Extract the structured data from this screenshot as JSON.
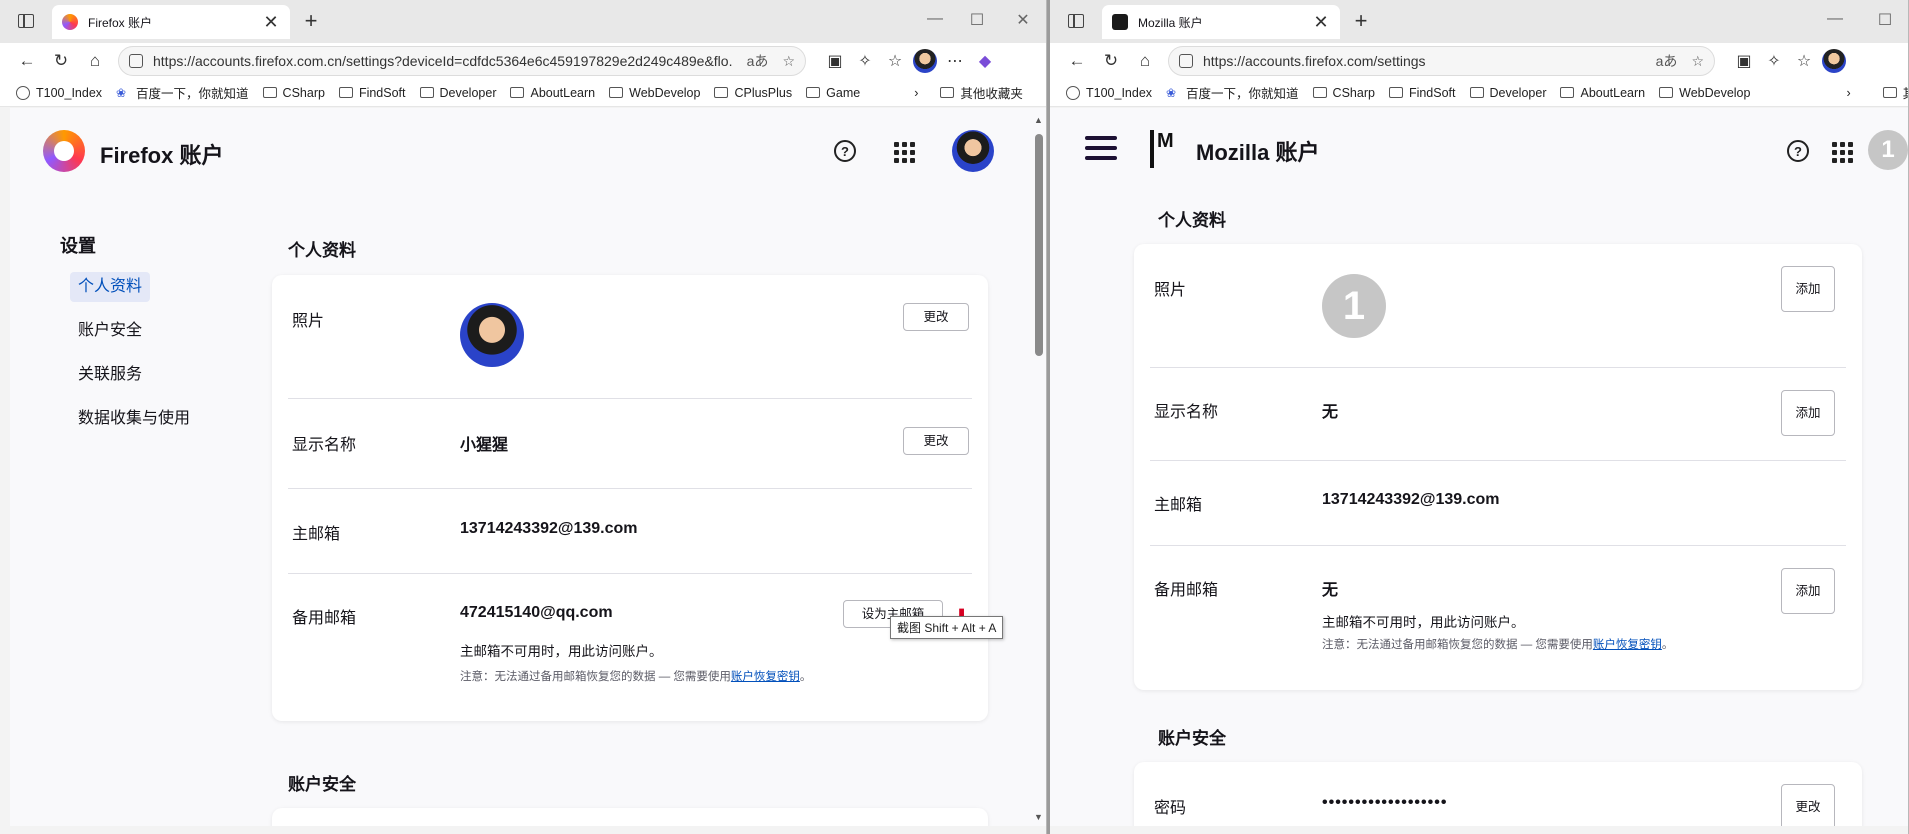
{
  "left": {
    "tab_title": "Firefox 账户",
    "url": "https://accounts.firefox.com.cn/settings?deviceId=cdfdc5364e6c459197829e2d249c489e&flo...",
    "bookmarks": [
      "T100_Index",
      "百度一下，你就知道",
      "CSharp",
      "FindSoft",
      "Developer",
      "AboutLearn",
      "WebDevelop",
      "CPlusPlus",
      "Game"
    ],
    "other_bookmarks": "其他收藏夹",
    "brand": "Firefox 账户",
    "sidebar": {
      "title": "设置",
      "items": [
        {
          "label": "个人资料"
        },
        {
          "label": "账户安全"
        },
        {
          "label": "关联服务"
        },
        {
          "label": "数据收集与使用"
        }
      ]
    },
    "profile": {
      "section_title": "个人资料",
      "photo_label": "照片",
      "photo_button": "更改",
      "display_name_label": "显示名称",
      "display_name_value": "小猩猩",
      "display_name_button": "更改",
      "primary_email_label": "主邮箱",
      "primary_email_value": "13714243392@139.com",
      "secondary_email_label": "备用邮箱",
      "secondary_email_value": "472415140@qq.com",
      "set_primary_button": "设为主邮箱",
      "secondary_desc": "主邮箱不可用时，用此访问账户。",
      "secondary_note": "注意：无法通过备用邮箱恢复您的数据 — 您需要使用",
      "secondary_link": "账户恢复密钥",
      "secondary_note_end": "。"
    },
    "tooltip": "截图 Shift + Alt + A",
    "security_title": "账户安全"
  },
  "right": {
    "tab_title": "Mozilla 账户",
    "url": "https://accounts.firefox.com/settings",
    "bookmarks": [
      "T100_Index",
      "百度一下，你就知道",
      "CSharp",
      "FindSoft",
      "Developer",
      "AboutLearn",
      "WebDevelop"
    ],
    "other_bookmarks": "其他",
    "brand": "Mozilla 账户",
    "avatar_letter": "1",
    "profile": {
      "section_title": "个人资料",
      "photo_label": "照片",
      "photo_letter": "1",
      "photo_button": "添加",
      "display_name_label": "显示名称",
      "display_name_value": "无",
      "display_name_button": "添加",
      "primary_email_label": "主邮箱",
      "primary_email_value": "13714243392@139.com",
      "secondary_email_label": "备用邮箱",
      "secondary_email_value": "无",
      "secondary_button": "添加",
      "secondary_desc": "主邮箱不可用时，用此访问账户。",
      "secondary_note": "注意：无法通过备用邮箱恢复您的数据 — 您需要使用",
      "secondary_link": "账户恢复密钥",
      "secondary_note_end": "。"
    },
    "security": {
      "section_title": "账户安全",
      "password_label": "密码",
      "password_value": "•••••••••••••••••••",
      "password_button": "更改"
    }
  },
  "icons": {
    "back": "←",
    "reload": "↻",
    "home": "⌂",
    "more": "⋯",
    "new_tab": "+",
    "close": "✕",
    "minimize": "—",
    "maximize": "☐",
    "chevron": "›",
    "star": "☆",
    "read_aloud": "aあ",
    "trash": "🗑"
  },
  "colors": {
    "link": "#0250bb",
    "active_nav_bg": "#e4e8f7",
    "danger": "#d70022"
  }
}
